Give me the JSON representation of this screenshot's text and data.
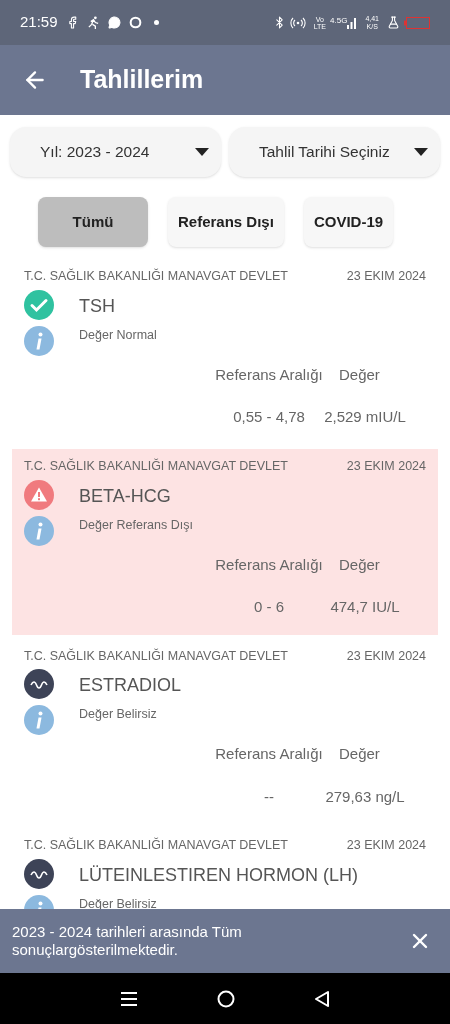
{
  "status_bar": {
    "time": "21:59",
    "volte": [
      "Vo",
      "LTE"
    ],
    "network": "4.5G",
    "speed": [
      "4,41",
      "K/S"
    ]
  },
  "header": {
    "title": "Tahlillerim"
  },
  "filters": [
    {
      "label": "Yıl: 2023 - 2024"
    },
    {
      "label": "Tahlil Tarihi Seçiniz"
    }
  ],
  "chips": [
    {
      "label": "Tümü",
      "selected": true
    },
    {
      "label": "Referans Dışı",
      "selected": false
    },
    {
      "label": "COVID-19",
      "selected": false
    }
  ],
  "results": [
    {
      "kind": "normal",
      "institution": "T.C. SAĞLIK BAKANLIĞI MANAVGAT DEVLET",
      "date": "23 EKIM 2024",
      "test": "TSH",
      "status": "Değer Normal",
      "reference_label": "Referans Aralığı",
      "value_label": "Değer",
      "reference": "0,55 - 4,78",
      "value": "2,529 mIU/L"
    },
    {
      "kind": "out_of_range",
      "institution": "T.C. SAĞLIK BAKANLIĞI MANAVGAT DEVLET",
      "date": "23 EKIM 2024",
      "test": "BETA-HCG",
      "status": "Değer Referans Dışı",
      "reference_label": "Referans Aralığı",
      "value_label": "Değer",
      "reference": "0 - 6",
      "value": "474,7 IU/L"
    },
    {
      "kind": "uncertain",
      "institution": "T.C. SAĞLIK BAKANLIĞI MANAVGAT DEVLET",
      "date": "23 EKIM 2024",
      "test": "ESTRADIOL",
      "status": "Değer Belirsiz",
      "reference_label": "Referans Aralığı",
      "value_label": "Değer",
      "reference": "--",
      "value": "279,63 ng/L"
    },
    {
      "kind": "uncertain",
      "institution": "T.C. SAĞLIK BAKANLIĞI MANAVGAT DEVLET",
      "date": "23 EKIM 2024",
      "test": "LÜTEINLESTIREN HORMON (LH)",
      "status": "Değer Belirsiz"
    }
  ],
  "snackbar": {
    "message": "2023 - 2024 tarihleri arasında Tüm sonuçlargösterilmektedir."
  }
}
